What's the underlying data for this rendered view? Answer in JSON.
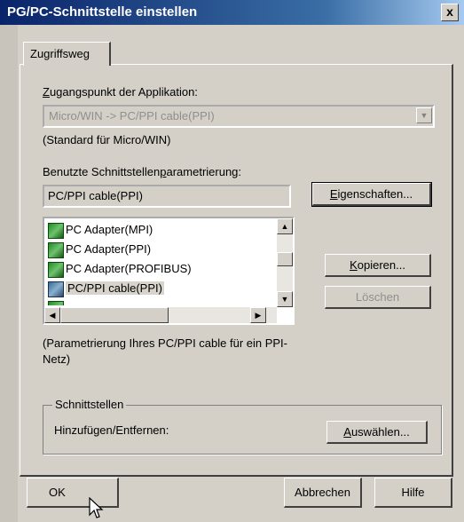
{
  "window": {
    "title": "PG/PC-Schnittstelle einstellen",
    "close": "x"
  },
  "tabs": [
    {
      "label": "Zugriffsweg"
    }
  ],
  "access_point": {
    "label_prefix": "",
    "label_u": "Z",
    "label_rest": "ugangspunkt der Applikation:",
    "value": "Micro/WIN      -> PC/PPI cable(PPI)",
    "hint": "(Standard für Micro/WIN)"
  },
  "parameter": {
    "label_pre": "Benutzte Schnittstellen",
    "label_u": "p",
    "label_post": "arametrierung:",
    "value": "PC/PPI cable(PPI)"
  },
  "interfaces": [
    {
      "label": "PC Adapter(MPI)",
      "selected": false
    },
    {
      "label": "PC Adapter(PPI)",
      "selected": false
    },
    {
      "label": "PC Adapter(PROFIBUS)",
      "selected": false
    },
    {
      "label": "PC/PPI cable(PPI)",
      "selected": true
    }
  ],
  "description": "(Parametrierung Ihres PC/PPI cable für ein PPI-Netz)",
  "buttons": {
    "properties_u": "E",
    "properties_rest": "igenschaften...",
    "copy_u": "K",
    "copy_rest": "opieren...",
    "delete": "Löschen",
    "select_u": "A",
    "select_rest": "uswählen...",
    "ok": "OK",
    "cancel": "Abbrechen",
    "help": "Hilfe"
  },
  "group": {
    "legend": "Schnittstellen",
    "label": "Hinzufügen/Entfernen:"
  }
}
